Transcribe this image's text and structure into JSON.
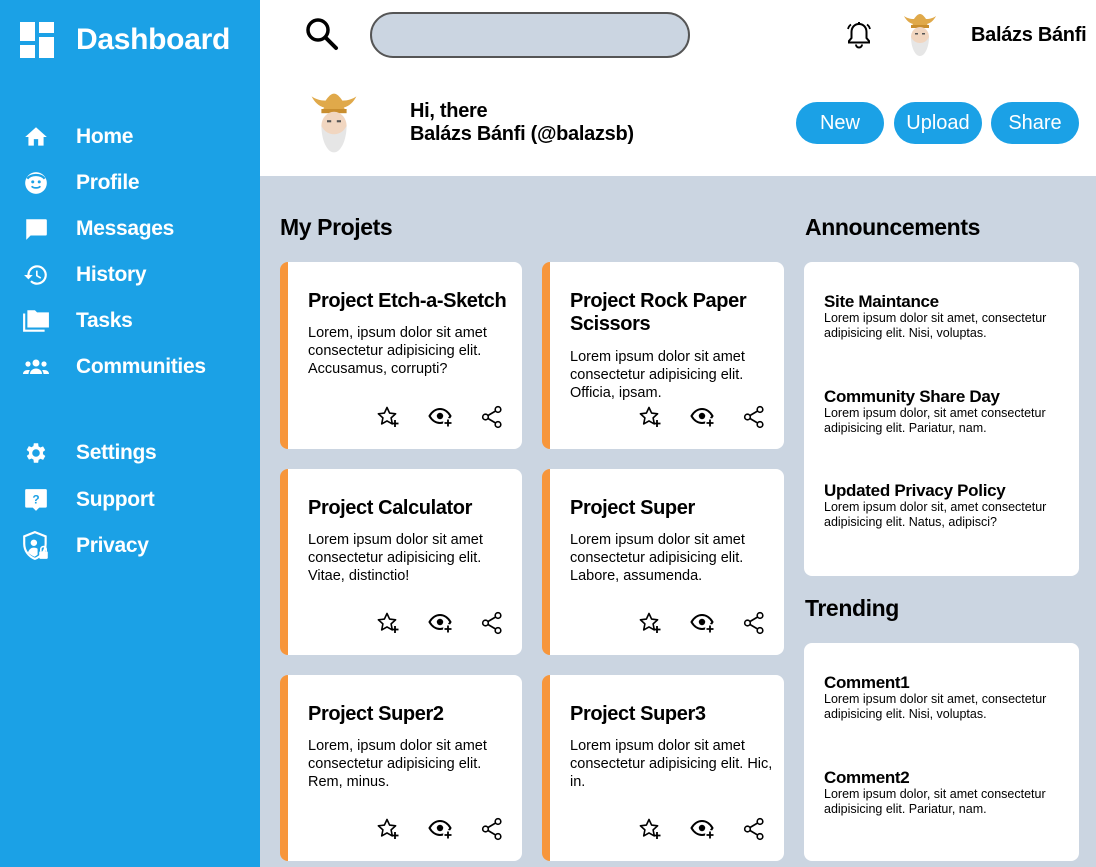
{
  "sidebar": {
    "brand": "Dashboard",
    "nav": [
      {
        "label": "Home",
        "icon": "home-icon"
      },
      {
        "label": "Profile",
        "icon": "profile-icon"
      },
      {
        "label": "Messages",
        "icon": "messages-icon"
      },
      {
        "label": "History",
        "icon": "history-icon"
      },
      {
        "label": "Tasks",
        "icon": "folder-icon"
      },
      {
        "label": "Communities",
        "icon": "communities-icon"
      }
    ],
    "secondary_nav": [
      {
        "label": "Settings",
        "icon": "gear-icon"
      },
      {
        "label": "Support",
        "icon": "support-icon"
      },
      {
        "label": "Privacy",
        "icon": "privacy-icon"
      }
    ]
  },
  "header": {
    "search_placeholder": "",
    "username": "Balázs Bánfi"
  },
  "greeting": {
    "hi": "Hi, there",
    "name": "Balázs Bánfi (@balazsb)",
    "buttons": {
      "new": "New",
      "upload": "Upload",
      "share": "Share"
    }
  },
  "projects": {
    "title": "My Projets",
    "cards": [
      {
        "title": "Project Etch-a-Sketch",
        "desc": "Lorem, ipsum dolor sit amet consectetur adipisicing elit. Accusamus, corrupti?"
      },
      {
        "title": "Project Rock Paper Scissors",
        "desc": "Lorem ipsum dolor sit amet consectetur adipisicing elit. Officia, ipsam."
      },
      {
        "title": "Project Calculator",
        "desc": "Lorem ipsum dolor sit amet consectetur adipisicing elit. Vitae, distinctio!"
      },
      {
        "title": "Project Super",
        "desc": "Lorem ipsum dolor sit amet consectetur adipisicing elit. Labore, assumenda."
      },
      {
        "title": "Project Super2",
        "desc": "Lorem, ipsum dolor sit amet consectetur adipisicing elit. Rem, minus."
      },
      {
        "title": "Project Super3",
        "desc": "Lorem ipsum dolor sit amet consectetur adipisicing elit. Hic, in."
      }
    ]
  },
  "announcements": {
    "title": "Announcements",
    "items": [
      {
        "title": "Site Maintance",
        "text": "Lorem ipsum dolor sit amet, consectetur adipisicing elit. Nisi, voluptas."
      },
      {
        "title": "Community Share Day",
        "text": "Lorem ipsum dolor, sit amet consectetur adipisicing elit. Pariatur, nam."
      },
      {
        "title": "Updated Privacy Policy",
        "text": "Lorem ipsum dolor sit, amet consectetur adipisicing elit. Natus, adipisci?"
      }
    ]
  },
  "trending": {
    "title": "Trending",
    "items": [
      {
        "title": "Comment1",
        "text": "Lorem ipsum dolor sit amet, consectetur adipisicing elit. Nisi, voluptas."
      },
      {
        "title": "Comment2",
        "text": "Lorem ipsum dolor, sit amet consectetur adipisicing elit. Pariatur, nam."
      }
    ]
  },
  "colors": {
    "sidebar": "#1ba1e6",
    "accent": "#f7963b",
    "background": "#cbd5e1"
  }
}
